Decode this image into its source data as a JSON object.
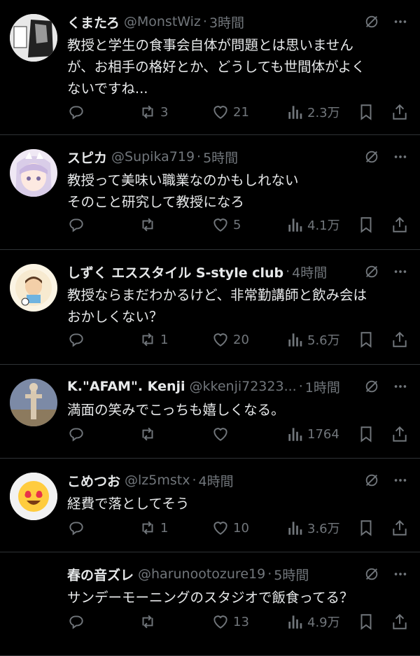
{
  "tweets": [
    {
      "name": "くまたろ",
      "handle": "@MonstWiz",
      "time": "3時間",
      "lines": [
        "教授と学生の食事会自体が問題とは思いません",
        "が、お相手の格好とか、どうしても世間体がよく",
        "ないですね..."
      ],
      "retweets": "3",
      "likes": "21",
      "views": "2.3万"
    },
    {
      "name": "スピカ",
      "handle": "@Supika719",
      "time": "5時間",
      "lines": [
        "教授って美味い職業なのかもしれない",
        "そのこと研究して教授になろ"
      ],
      "retweets": "",
      "likes": "5",
      "views": "4.1万"
    },
    {
      "name": "しずく エススタイル S-style club",
      "handle": "",
      "time": "4時間",
      "lines": [
        "教授ならまだわかるけど、非常勤講師と飲み会は",
        "おかしくない？"
      ],
      "retweets": "1",
      "likes": "20",
      "views": "5.6万"
    },
    {
      "name": "K.\"AFAM\". Kenji",
      "handle": "@kkenji72323...",
      "time": "1時間",
      "lines": [
        "満面の笑みでこっちも嬉しくなる。"
      ],
      "retweets": "",
      "likes": "",
      "views": "1764"
    },
    {
      "name": "こめつお",
      "handle": "@lz5mstx",
      "time": "4時間",
      "lines": [
        "経費で落としてそう"
      ],
      "retweets": "1",
      "likes": "10",
      "views": "3.6万"
    },
    {
      "name": "春の音ズレ",
      "handle": "@harunootozure19",
      "time": "5時間",
      "lines": [
        "サンデーモーニングのスタジオで飯食ってる？"
      ],
      "retweets": "",
      "likes": "13",
      "views": "4.9万"
    }
  ],
  "colors": {
    "background": "#000000",
    "text": "#e7e9ea",
    "muted": "#71767b",
    "divider": "#2f3336"
  }
}
